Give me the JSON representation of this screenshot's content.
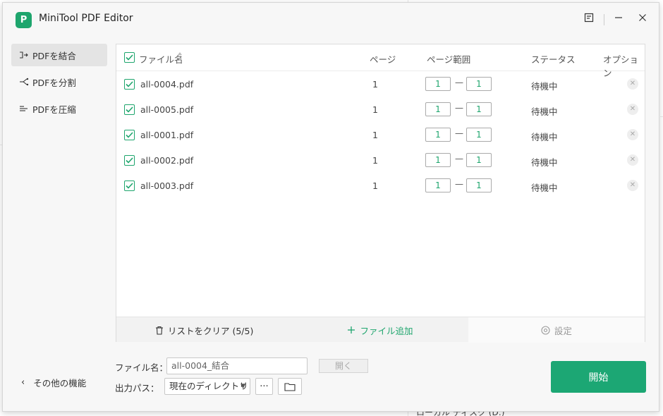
{
  "window": {
    "app_title": "MiniTool PDF Editor",
    "logo_text": "P"
  },
  "sidebar": {
    "items": [
      {
        "label": "PDFを結合",
        "icon": "merge-icon",
        "active": true
      },
      {
        "label": "PDFを分割",
        "icon": "split-icon",
        "active": false
      },
      {
        "label": "PDFを圧縮",
        "icon": "compress-icon",
        "active": false
      }
    ],
    "more_label": "その他の機能"
  },
  "list": {
    "headers": {
      "filename": "ファイル名",
      "pages": "ページ",
      "page_range": "ページ範囲",
      "status": "ステータス",
      "options": "オプション"
    },
    "rows": [
      {
        "filename": "all-0004.pdf",
        "pages": "1",
        "range_from": "1",
        "range_to": "1",
        "status": "待機中"
      },
      {
        "filename": "all-0005.pdf",
        "pages": "1",
        "range_from": "1",
        "range_to": "1",
        "status": "待機中"
      },
      {
        "filename": "all-0001.pdf",
        "pages": "1",
        "range_from": "1",
        "range_to": "1",
        "status": "待機中"
      },
      {
        "filename": "all-0002.pdf",
        "pages": "1",
        "range_from": "1",
        "range_to": "1",
        "status": "待機中"
      },
      {
        "filename": "all-0003.pdf",
        "pages": "1",
        "range_from": "1",
        "range_to": "1",
        "status": "待機中"
      }
    ],
    "range_separator": "—",
    "footer": {
      "clear_label": "リストをクリア (5/5)",
      "add_label": "ファイル追加",
      "settings_label": "設定"
    }
  },
  "form": {
    "filename_label": "ファイル名：",
    "filename_value": "all-0004_結合",
    "open_label": "開く",
    "output_label": "出力パス：",
    "output_value": "現在のディレクトリ",
    "browse_label": "···"
  },
  "start_label": "開始",
  "background": {
    "bottom_text": "ローカル ディスク (D:)"
  },
  "colors": {
    "accent": "#1ea56d",
    "start_button": "#1ca774"
  }
}
